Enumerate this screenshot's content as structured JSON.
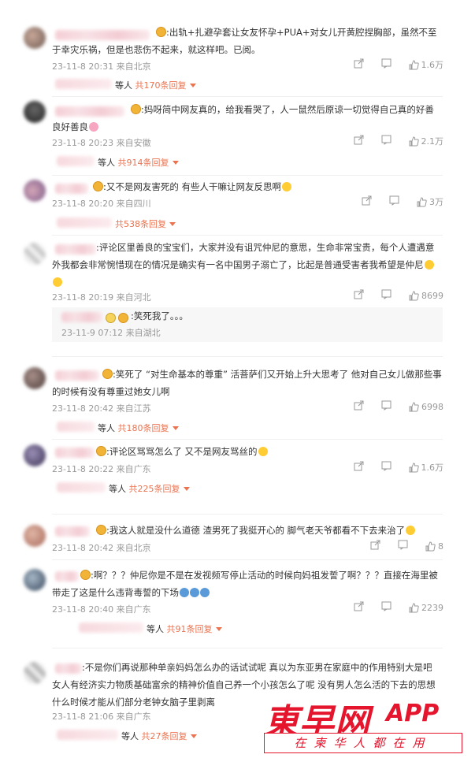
{
  "comments": [
    {
      "text": ":出轨+扎避孕套让女友怀孕+PUA+对女儿开黄腔捏胸部，虽然不至于幸灾乐祸，但是也悲伤不起来，就这样吧。已阅。",
      "time": "23-11-8 20:31 来自北京",
      "likes": "1.6万",
      "reply_prefix": "等人",
      "reply_count": "共170条回复"
    },
    {
      "text": ":妈呀简中网友真的，给我看哭了，人一鼠然后原谅一切觉得自己真的好善良好善良",
      "time": "23-11-8 20:23 来自安徽",
      "likes": "2.1万",
      "reply_prefix": "等人",
      "reply_count": "共914条回复"
    },
    {
      "text": ":又不是网友害死的 有些人干嘛让网友反思啊",
      "time": "23-11-8 20:20 来自四川",
      "likes": "3万",
      "reply_prefix": "",
      "reply_count": "共538条回复"
    },
    {
      "text": ":评论区里善良的宝宝们，大家并没有诅咒仲尼的意思，生命非常宝贵，每个人遭遇意外我都会非常惋惜现在的情况是确实有一名中国男子溺亡了，比起是普通受害者我希望是仲尼",
      "time": "23-11-8 20:19 来自河北",
      "likes": "8699",
      "sub_text": ":笑死我了。。。",
      "sub_time": "23-11-9 07:12 来自湖北"
    },
    {
      "text": ":笑死了 “对生命基本的尊重” 活菩萨们又开始上升大思考了 他对自己女儿做那些事的时候有没有尊重过她女儿啊",
      "time": "23-11-8 20:42 来自江苏",
      "likes": "6998",
      "reply_prefix": "等人",
      "reply_count": "共180条回复"
    },
    {
      "text": ":评论区骂骂怎么了 又不是网友骂丝的",
      "time": "23-11-8 20:22 来自广东",
      "likes": "1.6万",
      "reply_prefix": "等人",
      "reply_count": "共225条回复"
    },
    {
      "text": ":我这人就是没什么道德 渣男死了我挺开心的 脚气老天爷都看不下去来治了",
      "time": "23-11-8 20:42 来自北京",
      "likes": "8"
    },
    {
      "text": ":啊？？？仲尼你是不是在发视频写停止活动的时候向妈祖发誓了啊？？？直接在海里被带走了这是什么违背毒誓的下场",
      "time": "23-11-8 20:40 来自广东",
      "likes": "2239",
      "reply_prefix": "等人",
      "reply_count": "共91条回复"
    },
    {
      "text": ":不是你们再说那种单亲妈妈怎么办的话试试呢 真以为东亚男在家庭中的作用特别大是吧 女人有经济实力物质基础富余的精神价值自己养一个小孩怎么了呢 没有男人怎么活的下去的思想什么时候才能从们部分老钟女脑子里剥离",
      "time": "23-11-8 21:06 来自广东",
      "likes": "",
      "reply_prefix": "等人",
      "reply_count": "共27条回复"
    }
  ],
  "watermark": {
    "brand": "東早网",
    "app": "APP",
    "slogan": "在柬华人都在用"
  },
  "colors": {
    "accent": "#eb7350",
    "brand": "#e4152c"
  }
}
